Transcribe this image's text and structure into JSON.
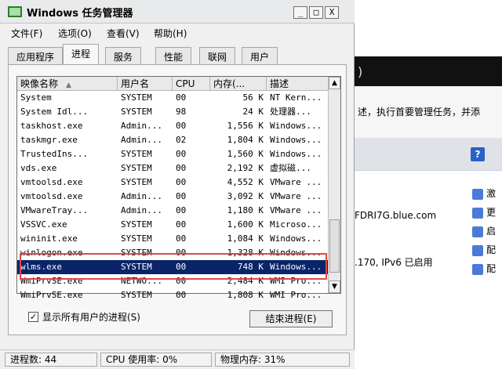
{
  "bg": {
    "line1": "述，执行首要管理任务，并添",
    "line2": "FDRI7G.blue.com",
    "line3": ".170, IPv6 已启用",
    "help_label": "?",
    "side_links": [
      "激",
      "更",
      "启",
      "配",
      "配"
    ]
  },
  "window": {
    "title": "Windows 任务管理器",
    "min": "_",
    "max": "□",
    "close": "X"
  },
  "menu": {
    "file": "文件(F)",
    "options": "选项(O)",
    "view": "查看(V)",
    "help": "帮助(H)"
  },
  "tabs": {
    "apps": "应用程序",
    "processes": "进程",
    "services": "服务",
    "performance": "性能",
    "network": "联网",
    "users": "用户"
  },
  "table": {
    "headers": {
      "image": "映像名称",
      "user": "用户名",
      "cpu": "CPU",
      "mem": "内存(...",
      "desc": "描述"
    },
    "rows": [
      {
        "image": "System",
        "user": "SYSTEM",
        "cpu": "00",
        "mem": "56 K",
        "desc": "NT Kern..."
      },
      {
        "image": "System Idl...",
        "user": "SYSTEM",
        "cpu": "98",
        "mem": "24 K",
        "desc": "处理器..."
      },
      {
        "image": "taskhost.exe",
        "user": "Admin...",
        "cpu": "00",
        "mem": "1,556 K",
        "desc": "Windows..."
      },
      {
        "image": "taskmgr.exe",
        "user": "Admin...",
        "cpu": "02",
        "mem": "1,804 K",
        "desc": "Windows..."
      },
      {
        "image": "TrustedIns...",
        "user": "SYSTEM",
        "cpu": "00",
        "mem": "1,560 K",
        "desc": "Windows..."
      },
      {
        "image": "vds.exe",
        "user": "SYSTEM",
        "cpu": "00",
        "mem": "2,192 K",
        "desc": "虚拟磁..."
      },
      {
        "image": "vmtoolsd.exe",
        "user": "SYSTEM",
        "cpu": "00",
        "mem": "4,552 K",
        "desc": "VMware ..."
      },
      {
        "image": "vmtoolsd.exe",
        "user": "Admin...",
        "cpu": "00",
        "mem": "3,092 K",
        "desc": "VMware ..."
      },
      {
        "image": "VMwareTray...",
        "user": "Admin...",
        "cpu": "00",
        "mem": "1,180 K",
        "desc": "VMware ..."
      },
      {
        "image": "VSSVC.exe",
        "user": "SYSTEM",
        "cpu": "00",
        "mem": "1,600 K",
        "desc": "Microso..."
      },
      {
        "image": "wininit.exe",
        "user": "SYSTEM",
        "cpu": "00",
        "mem": "1,084 K",
        "desc": "Windows..."
      },
      {
        "image": "winlogon.exe",
        "user": "SYSTEM",
        "cpu": "00",
        "mem": "1,328 K",
        "desc": "Windows..."
      },
      {
        "image": "wlms.exe",
        "user": "SYSTEM",
        "cpu": "00",
        "mem": "748 K",
        "desc": "Windows..."
      },
      {
        "image": "WmiPrvSE.exe",
        "user": "NETWO...",
        "cpu": "00",
        "mem": "2,484 K",
        "desc": "WMI Pro..."
      },
      {
        "image": "WmiPrvSE.exe",
        "user": "SYSTEM",
        "cpu": "00",
        "mem": "1,808 K",
        "desc": "WMI Pro..."
      }
    ],
    "selected_index": 12
  },
  "controls": {
    "show_all_label": "显示所有用户的进程(S)",
    "show_all_checked": true,
    "checkmark": "✓",
    "end_process": "结束进程(E)"
  },
  "status": {
    "processes": "进程数: 44",
    "cpu": "CPU 使用率: 0%",
    "memory": "物理内存: 31%"
  }
}
